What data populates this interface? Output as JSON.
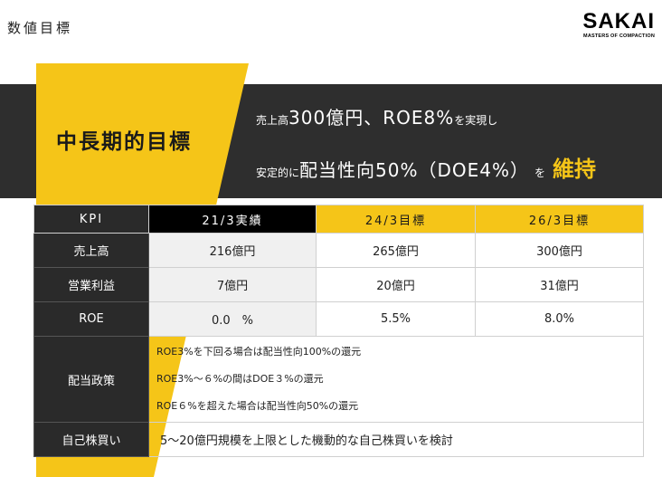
{
  "header": {
    "title": "数値目標",
    "logo_main": "SAKAI",
    "logo_sub": "MASTERS OF COMPACTION"
  },
  "banner": {
    "heading": "中長期的目標",
    "line1_a": "売上高",
    "line1_b": "300億円、ROE8%",
    "line1_c": "を実現し",
    "line2_a": "安定的に",
    "line2_b": "配当性向50%（DOE4%）",
    "line2_c": "を",
    "line2_d": "維持"
  },
  "table": {
    "headers": [
      "KPI",
      "21/3実績",
      "24/3目標",
      "26/3目標"
    ],
    "rows": [
      {
        "label": "売上高",
        "values": [
          "216億円",
          "265億円",
          "300億円"
        ]
      },
      {
        "label": "営業利益",
        "values": [
          "7億円",
          "20億円",
          "31億円"
        ]
      },
      {
        "label": "ROE",
        "values": [
          "0.0　%",
          "5.5%",
          "8.0%"
        ]
      }
    ],
    "policy": {
      "label": "配当政策",
      "lines": [
        "ROE3%を下回る場合は配当性向100%の還元",
        "ROE3%～６%の間はDOE３%の還元",
        "ROE６%を超えた場合は配当性向50%の還元"
      ]
    },
    "buyback": {
      "label": "自己株買い",
      "text": "5～20億円規模を上限とした機動的な自己株買いを検討"
    }
  },
  "colors": {
    "accent_yellow": "#f5c518",
    "band_dark": "#2e2e2e",
    "label_dark": "#2a2a2a"
  }
}
